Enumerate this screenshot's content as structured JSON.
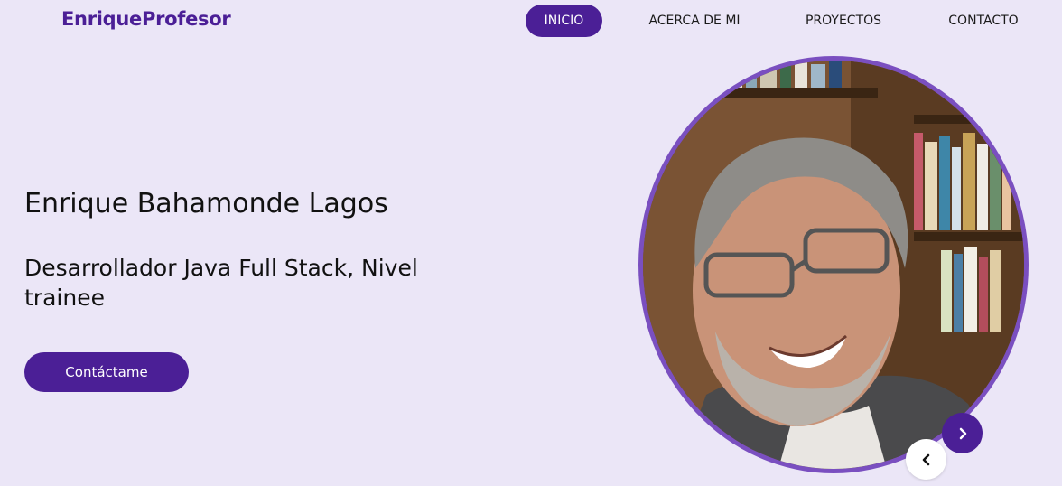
{
  "brand": {
    "name": "EnriqueProfesor"
  },
  "nav": {
    "items": [
      {
        "label": "INICIO",
        "active": true
      },
      {
        "label": "ACERCA DE MI",
        "active": false
      },
      {
        "label": "PROYECTOS",
        "active": false
      },
      {
        "label": "CONTACTO",
        "active": false
      }
    ]
  },
  "hero": {
    "name": "Enrique Bahamonde Lagos",
    "role": "Desarrollador Java Full Stack, Nivel trainee",
    "cta_label": "Contáctame"
  },
  "carousel": {
    "next_icon": "chevron-right-icon",
    "prev_icon": "chevron-left-icon"
  },
  "colors": {
    "background": "#ebe6f7",
    "accent": "#4b1f96",
    "frame": "#7a4fc0"
  }
}
